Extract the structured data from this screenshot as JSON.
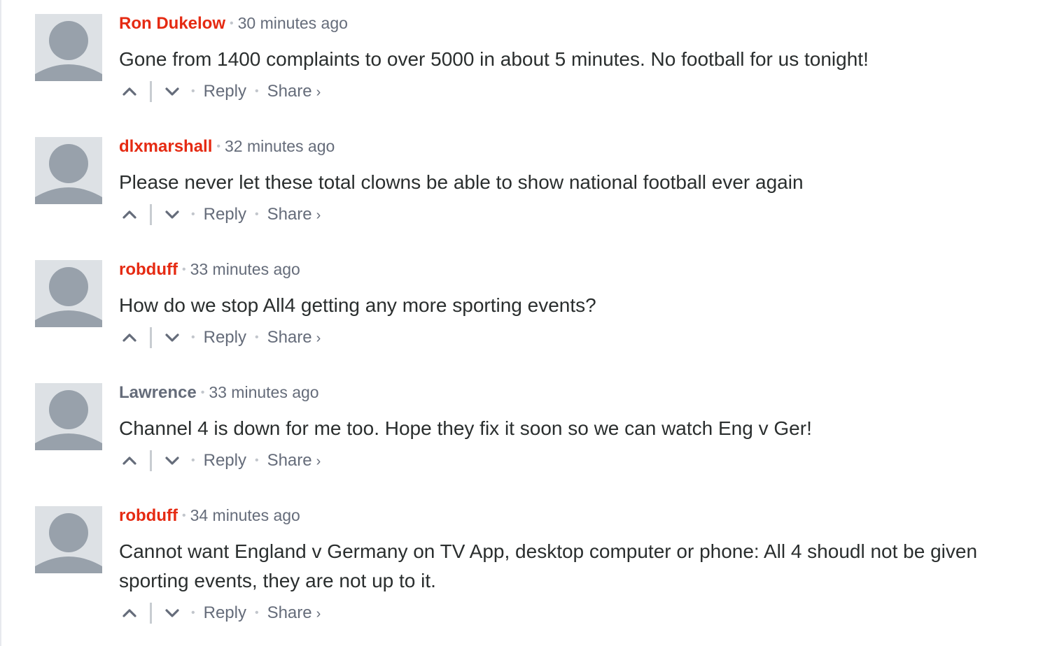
{
  "actions": {
    "reply_label": "Reply",
    "share_label": "Share",
    "share_chevron": "›",
    "upvote_icon": "chevron-up-icon",
    "downvote_icon": "chevron-down-icon"
  },
  "colors": {
    "author_highlight": "#e52a12",
    "author_plain": "#656c7a",
    "meta_text": "#656c7a",
    "body_text": "#2a2e2e",
    "avatar_bg": "#dde1e5",
    "avatar_fg": "#98a1ab"
  },
  "comments": [
    {
      "author": "Ron Dukelow",
      "time": "30 minutes ago",
      "message": "Gone from 1400 complaints to over 5000 in about 5 minutes. No football for us tonight!"
    },
    {
      "author": "dlxmarshall",
      "time": "32 minutes ago",
      "message": "Please never let these total clowns be able to show national football ever again"
    },
    {
      "author": "robduff",
      "time": "33 minutes ago",
      "message": "How do we stop All4 getting any more sporting events?"
    },
    {
      "author": "Lawrence",
      "time": "33 minutes ago",
      "message": "Channel 4 is down for me too. Hope they fix it soon so we can watch Eng v Ger!"
    },
    {
      "author": "robduff",
      "time": "34 minutes ago",
      "message": "Cannot want England v Germany on TV App, desktop computer or phone: All 4 shoudl not be given sporting events, they are not up to it."
    }
  ]
}
